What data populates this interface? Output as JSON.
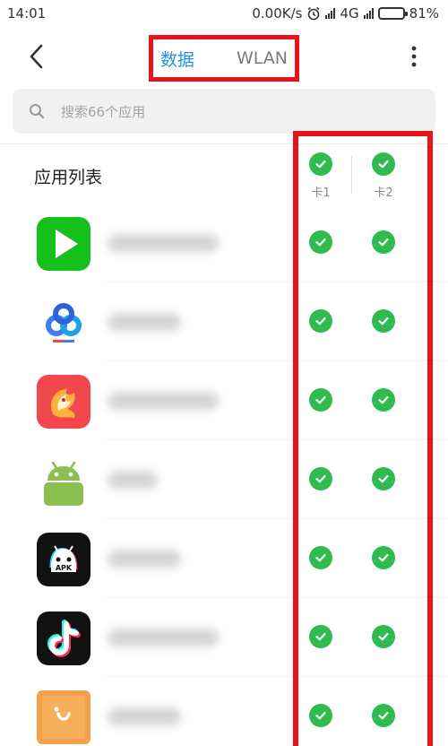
{
  "status_bar": {
    "time": "14:01",
    "speed": "0.00K/s",
    "network": "4G",
    "battery": "81%",
    "battery_level": 0.81
  },
  "header": {
    "tabs": [
      {
        "label": "数据",
        "active": true
      },
      {
        "label": "WLAN",
        "active": false
      }
    ],
    "back_icon": "chevron-left-icon",
    "more_icon": "more-vertical-icon"
  },
  "search": {
    "placeholder": "搜索66个应用",
    "icon": "search-icon"
  },
  "list": {
    "title": "应用列表",
    "columns": [
      {
        "label": "卡1",
        "checked": true
      },
      {
        "label": "卡2",
        "checked": true
      }
    ],
    "apps": [
      {
        "icon": "iqiyi-play-icon",
        "card1": true,
        "card2": true
      },
      {
        "icon": "baidu-netdisk-icon",
        "card1": true,
        "card2": true
      },
      {
        "icon": "rooster-app-icon",
        "card1": true,
        "card2": true
      },
      {
        "icon": "android-icon",
        "card1": true,
        "card2": true
      },
      {
        "icon": "apk-installer-icon",
        "card1": true,
        "card2": true
      },
      {
        "icon": "tiktok-icon",
        "card1": true,
        "card2": true
      },
      {
        "icon": "book-smile-icon",
        "card1": true,
        "card2": true
      }
    ]
  },
  "colors": {
    "accent": "#1e94e6",
    "check": "#2fbb4f",
    "highlight": "#e8131a"
  }
}
